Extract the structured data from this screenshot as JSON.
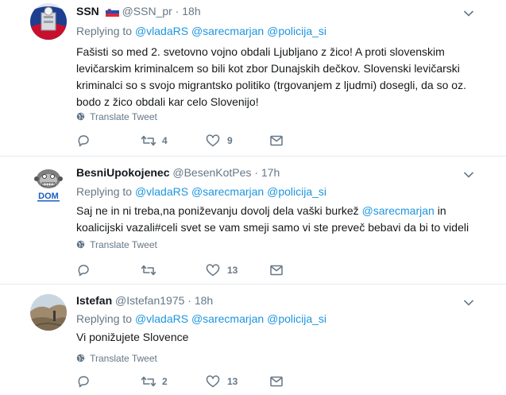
{
  "tweets": [
    {
      "name": "SSN",
      "handle": "@SSN_pr",
      "dot": "·",
      "time": "18h",
      "has_flag": true,
      "reply_prefix": "Replying to",
      "mentions": [
        "@vladaRS",
        "@sarecmarjan",
        "@policija_si"
      ],
      "text_lines": [
        "Fašisti so med 2. svetovno vojno obdali Ljubljano z žico! A proti slovenskim",
        "levičarskim kriminalcem so bili kot zbor Dunajskih dečkov. Slovenski levičarski",
        "kriminalci so s svojo migrantsko politiko (trgovanjem z ljudmi) dosegli, da so oz.",
        "bodo z žico obdali kar celo Slovenijo!"
      ],
      "translate": "Translate Tweet",
      "retweets": "4",
      "likes": "9"
    },
    {
      "name": "BesniUpokojenec",
      "handle": "@BesenKotPes",
      "dot": "·",
      "time": "17h",
      "has_flag": false,
      "reply_prefix": "Replying to",
      "mentions": [
        "@vladaRS",
        "@sarecmarjan",
        "@policija_si"
      ],
      "text_line1_a": "Saj ne in ni treba,na poniževanju dovolj dela vaški burkež ",
      "text_line1_mention": "@sarecmarjan",
      "text_line1_b": " in",
      "text_line2": "koalicijski vazali#celi svet se vam smeji samo vi ste preveč bebavi da bi to videli",
      "translate": "Translate Tweet",
      "retweets": "",
      "likes": "13"
    },
    {
      "name": "Istefan",
      "handle": "@Istefan1975",
      "dot": "·",
      "time": "18h",
      "has_flag": false,
      "reply_prefix": "Replying to",
      "mentions": [
        "@vladaRS",
        "@sarecmarjan",
        "@policija_si"
      ],
      "text_line1": "Vi ponižujete Slovence",
      "translate": "Translate Tweet",
      "retweets": "2",
      "likes": "13"
    }
  ],
  "avatar2_text": "DOM",
  "colors": {
    "link": "#1b95e0",
    "secondary": "#657786",
    "divider": "#e6ecf0"
  }
}
